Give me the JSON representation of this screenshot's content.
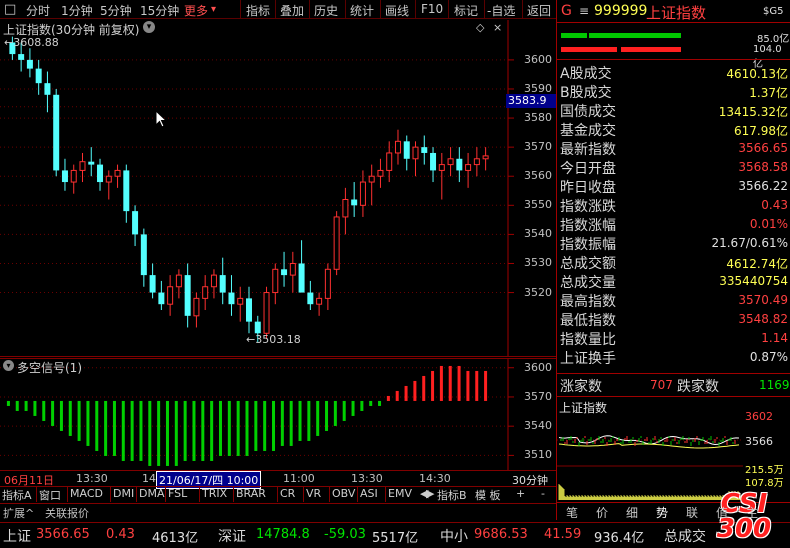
{
  "toolbar": {
    "items": [
      "分时",
      "1分钟",
      "5分钟",
      "15分钟",
      "更多",
      "指标",
      "叠加",
      "历史",
      "统计",
      "画线",
      "F10",
      "标记",
      "-自选",
      "返回"
    ],
    "more_arrow": "▾"
  },
  "main_chart": {
    "title": "上证指数(30分钟 前复权)",
    "high_label": "3608.88",
    "low_label": "3503.18",
    "cursor_price": "3583.9",
    "yticks": [
      "3600",
      "3590",
      "3580",
      "3570",
      "3560",
      "3550",
      "3540",
      "3530",
      "3520"
    ]
  },
  "sub_chart": {
    "title": "多空信号(1)",
    "yticks": [
      "3600",
      "3570",
      "3540",
      "3510"
    ]
  },
  "xaxis": {
    "labels": [
      "06月11日",
      "13:30",
      "14",
      "11:00",
      "13:30",
      "14:30"
    ],
    "cursor_time": "21/06/17/四 10:00",
    "period": "30分钟"
  },
  "bottom_tabs": [
    "指标A",
    "窗口",
    "MACD",
    "DMI",
    "DMA",
    "FSL",
    "TRIX",
    "BRAR",
    "CR",
    "VR",
    "OBV",
    "ASI",
    "EMV"
  ],
  "bottom_right": {
    "indicator_b": "指标B",
    "template": "模 板",
    "plus": "+",
    "minus": "-"
  },
  "ext_tabs": [
    "扩展^",
    "关联报价"
  ],
  "quote": {
    "letter": "G",
    "menu": "≡",
    "code": "999999",
    "name": "上证指数",
    "badge": "$G5",
    "bar_up": "85.0亿",
    "bar_dn": "104.0亿"
  },
  "quote_rows": [
    {
      "label": "A股成交",
      "value": "4610.13亿",
      "color": "y"
    },
    {
      "label": "B股成交",
      "value": "1.37亿",
      "color": "y"
    },
    {
      "label": "国债成交",
      "value": "13415.32亿",
      "color": "y"
    },
    {
      "label": "基金成交",
      "value": "617.98亿",
      "color": "y"
    },
    {
      "label": "最新指数",
      "value": "3566.65",
      "color": "r"
    },
    {
      "label": "今日开盘",
      "value": "3568.58",
      "color": "r"
    },
    {
      "label": "昨日收盘",
      "value": "3566.22",
      "color": "w"
    },
    {
      "label": "指数涨跌",
      "value": "0.43",
      "color": "r"
    },
    {
      "label": "指数涨幅",
      "value": "0.01%",
      "color": "r"
    },
    {
      "label": "指数振幅",
      "value": "21.67/0.61%",
      "color": "w"
    },
    {
      "label": "总成交额",
      "value": "4612.74亿",
      "color": "y"
    },
    {
      "label": "总成交量",
      "value": "335440754",
      "color": "y"
    },
    {
      "label": "最高指数",
      "value": "3570.49",
      "color": "r"
    },
    {
      "label": "最低指数",
      "value": "3548.82",
      "color": "r"
    },
    {
      "label": "指数量比",
      "value": "1.14",
      "color": "r"
    },
    {
      "label": "上证换手",
      "value": "0.87%",
      "color": "w"
    }
  ],
  "breadth": {
    "up_label": "涨家数",
    "up": "707",
    "down_label": "跌家数",
    "down": "1169"
  },
  "mini_chart": {
    "title": "上证指数",
    "yticks": [
      "3602",
      "3566",
      "215.5万",
      "107.8万"
    ]
  },
  "mini_tabs": [
    "笔",
    "价",
    "细",
    "势",
    "联",
    "值",
    "主"
  ],
  "ticker": [
    {
      "name": "上证",
      "price": "3566.65",
      "chg": "0.43",
      "amt": "4613亿"
    },
    {
      "name": "深证",
      "price": "14784.8",
      "chg": "-59.03",
      "amt": "5517亿"
    },
    {
      "name": "中小",
      "price": "9686.53",
      "chg": "41.59",
      "amt": "936.4亿"
    },
    {
      "name": "总成交",
      "price": "",
      "chg": "",
      "amt": ""
    }
  ],
  "logo": {
    "line1": "CSI",
    "line2": "300"
  },
  "candles": [
    [
      3606,
      3608,
      3600,
      3602
    ],
    [
      3602,
      3606,
      3596,
      3600
    ],
    [
      3600,
      3604,
      3594,
      3597
    ],
    [
      3597,
      3600,
      3588,
      3592
    ],
    [
      3592,
      3596,
      3582,
      3588
    ],
    [
      3588,
      3590,
      3560,
      3562
    ],
    [
      3562,
      3566,
      3555,
      3558
    ],
    [
      3558,
      3564,
      3554,
      3562
    ],
    [
      3562,
      3568,
      3558,
      3565
    ],
    [
      3565,
      3570,
      3560,
      3564
    ],
    [
      3564,
      3566,
      3555,
      3558
    ],
    [
      3558,
      3562,
      3552,
      3560
    ],
    [
      3560,
      3564,
      3556,
      3562
    ],
    [
      3562,
      3564,
      3544,
      3548
    ],
    [
      3548,
      3550,
      3536,
      3540
    ],
    [
      3540,
      3542,
      3522,
      3526
    ],
    [
      3526,
      3530,
      3518,
      3520
    ],
    [
      3520,
      3524,
      3514,
      3516
    ],
    [
      3516,
      3526,
      3512,
      3522
    ],
    [
      3522,
      3528,
      3518,
      3526
    ],
    [
      3526,
      3530,
      3508,
      3512
    ],
    [
      3512,
      3520,
      3508,
      3518
    ],
    [
      3518,
      3526,
      3514,
      3522
    ],
    [
      3522,
      3528,
      3518,
      3526
    ],
    [
      3526,
      3532,
      3516,
      3520
    ],
    [
      3520,
      3526,
      3512,
      3516
    ],
    [
      3516,
      3522,
      3510,
      3518
    ],
    [
      3518,
      3522,
      3506,
      3510
    ],
    [
      3510,
      3512,
      3503,
      3506
    ],
    [
      3506,
      3522,
      3504,
      3520
    ],
    [
      3520,
      3530,
      3516,
      3528
    ],
    [
      3528,
      3534,
      3522,
      3526
    ],
    [
      3526,
      3534,
      3520,
      3530
    ],
    [
      3530,
      3538,
      3526,
      3520
    ],
    [
      3520,
      3524,
      3514,
      3516
    ],
    [
      3516,
      3520,
      3512,
      3518
    ],
    [
      3518,
      3530,
      3514,
      3528
    ],
    [
      3528,
      3548,
      3526,
      3546
    ],
    [
      3546,
      3556,
      3540,
      3552
    ],
    [
      3552,
      3558,
      3546,
      3550
    ],
    [
      3550,
      3562,
      3546,
      3558
    ],
    [
      3558,
      3564,
      3550,
      3560
    ],
    [
      3560,
      3566,
      3556,
      3562
    ],
    [
      3562,
      3572,
      3558,
      3568
    ],
    [
      3568,
      3576,
      3564,
      3572
    ],
    [
      3572,
      3574,
      3562,
      3566
    ],
    [
      3566,
      3572,
      3560,
      3570
    ],
    [
      3570,
      3574,
      3564,
      3568
    ],
    [
      3568,
      3570,
      3558,
      3562
    ],
    [
      3562,
      3568,
      3552,
      3564
    ],
    [
      3564,
      3570,
      3560,
      3566
    ],
    [
      3566,
      3570,
      3558,
      3562
    ],
    [
      3562,
      3568,
      3556,
      3564
    ],
    [
      3564,
      3570,
      3560,
      3566
    ],
    [
      3566,
      3570,
      3562,
      3567
    ]
  ],
  "signal_bars": [
    -1,
    -2,
    -2,
    -3,
    -4,
    -5,
    -6,
    -7,
    -8,
    -9,
    -10,
    -11,
    -11,
    -12,
    -12,
    -12,
    -13,
    -13,
    -13,
    -13,
    -12,
    -12,
    -12,
    -12,
    -11,
    -11,
    -11,
    -11,
    -10,
    -10,
    -10,
    -9,
    -9,
    -8,
    -8,
    -7,
    -6,
    -5,
    -4,
    -3,
    -2,
    -1,
    -1,
    1,
    2,
    3,
    4,
    5,
    6,
    7,
    7,
    7,
    6,
    6,
    6
  ]
}
